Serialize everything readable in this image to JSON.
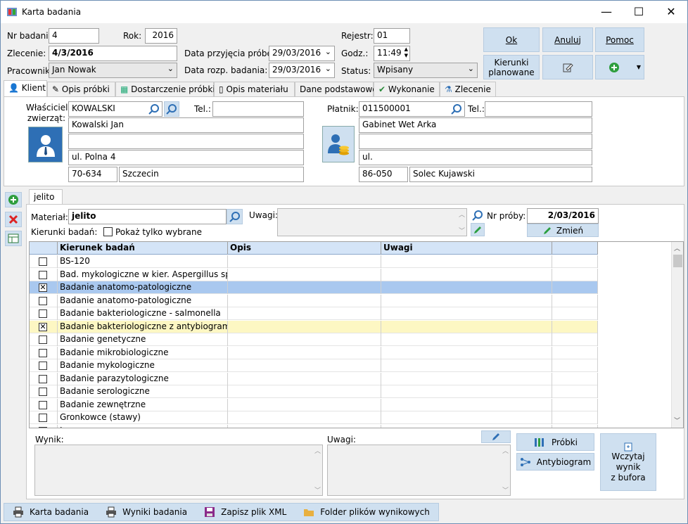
{
  "window": {
    "title": "Karta badania",
    "controls": {
      "minimize": "—",
      "maximize": "☐",
      "close": "✕"
    }
  },
  "header": {
    "nr_badania_label": "Nr badania",
    "nr_badania": "4",
    "rok_label": "Rok:",
    "rok": "2016",
    "rejestr_label": "Rejestr:",
    "rejestr": "01",
    "zlecenie_label": "Zlecenie:",
    "zlecenie": "4/3/2016",
    "data_przyjecia_label": "Data przyjęcia próbek:",
    "data_przyjecia": "29/03/2016",
    "godz_label": "Godz.:",
    "godz": "11:49",
    "pracownik_label": "Pracownik:",
    "pracownik": "Jan Nowak",
    "data_rozp_label": "Data rozp. badania:",
    "data_rozp": "29/03/2016",
    "status_label": "Status:",
    "status": "Wpisany"
  },
  "buttons": {
    "ok": "Ok",
    "anuluj": "Anuluj",
    "pomoc": "Pomoc",
    "kierunki_line1": "Kierunki",
    "kierunki_line2": "planowane"
  },
  "tabs": [
    "Klient",
    "Opis próbki",
    "Dostarczenie próbki",
    "Opis materiału",
    "Dane podstawowe",
    "Wykonanie",
    "Zlecenie"
  ],
  "owner": {
    "label_line1": "Właściciel",
    "label_line2": "zwierząt:",
    "code": "KOWALSKI",
    "name": "Kowalski Jan",
    "line2": "",
    "street": "ul. Polna 4",
    "zip": "70-634",
    "city": "Szczecin",
    "tel_label": "Tel.:",
    "tel": ""
  },
  "payer": {
    "label": "Płatnik:",
    "code": "011500001",
    "name": "Gabinet Wet Arka",
    "line2": "",
    "street": "ul.",
    "zip": "86-050",
    "city": "Solec Kujawski",
    "tel_label": "Tel.:",
    "tel": ""
  },
  "sample": {
    "tab": "jelito",
    "material_label": "Materiał:",
    "material": "jelito",
    "uwagi_label": "Uwagi:",
    "uwagi": "",
    "nr_proby_label": "Nr próby:",
    "nr_proby": "2/03/2016",
    "zmien": "Zmień",
    "kierunki_label": "Kierunki badań:",
    "pokaz_label": "Pokaż tylko wybrane"
  },
  "grid": {
    "headers": [
      "",
      "Kierunek badań",
      "Opis",
      "Uwagi",
      ""
    ],
    "rows": [
      {
        "checked": false,
        "name": "BS-120",
        "state": ""
      },
      {
        "checked": false,
        "name": "Bad. mykologiczne w kier. Aspergillus sp.",
        "state": ""
      },
      {
        "checked": true,
        "name": "Badanie anatomo-patologiczne",
        "state": "selected"
      },
      {
        "checked": false,
        "name": "Badanie anatomo-patologiczne",
        "state": ""
      },
      {
        "checked": false,
        "name": "Badanie bakteriologiczne - salmonella",
        "state": ""
      },
      {
        "checked": true,
        "name": "Badanie bakteriologiczne z antybiogramem",
        "state": "highlight"
      },
      {
        "checked": false,
        "name": "Badanie genetyczne",
        "state": ""
      },
      {
        "checked": false,
        "name": "Badanie mikrobiologiczne",
        "state": ""
      },
      {
        "checked": false,
        "name": "Badanie mykologiczne",
        "state": ""
      },
      {
        "checked": false,
        "name": "Badanie parazytologiczne",
        "state": ""
      },
      {
        "checked": false,
        "name": "Badanie serologiczne",
        "state": ""
      },
      {
        "checked": false,
        "name": "Badanie zewnętrzne",
        "state": ""
      },
      {
        "checked": false,
        "name": "Gronkowce (stawy)",
        "state": ""
      },
      {
        "checked": false,
        "name": "Inne",
        "state": ""
      }
    ]
  },
  "result": {
    "wynik_label": "Wynik:",
    "uwagi_label": "Uwagi:",
    "probki": "Próbki",
    "antybiogram": "Antybiogram",
    "wczytaj_line1": "Wczytaj wynik",
    "wczytaj_line2": "z bufora"
  },
  "bottom": {
    "karta": "Karta badania",
    "wyniki": "Wyniki badania",
    "zapisz": "Zapisz plik XML",
    "folder": "Folder plików wynikowych"
  },
  "colors": {
    "accent": "#2e6fb5",
    "button_bg": "#cfe0f0",
    "grid_header": "#d4e4f7",
    "row_selected": "#a9c8ef",
    "row_highlight": "#fdf7c3"
  }
}
